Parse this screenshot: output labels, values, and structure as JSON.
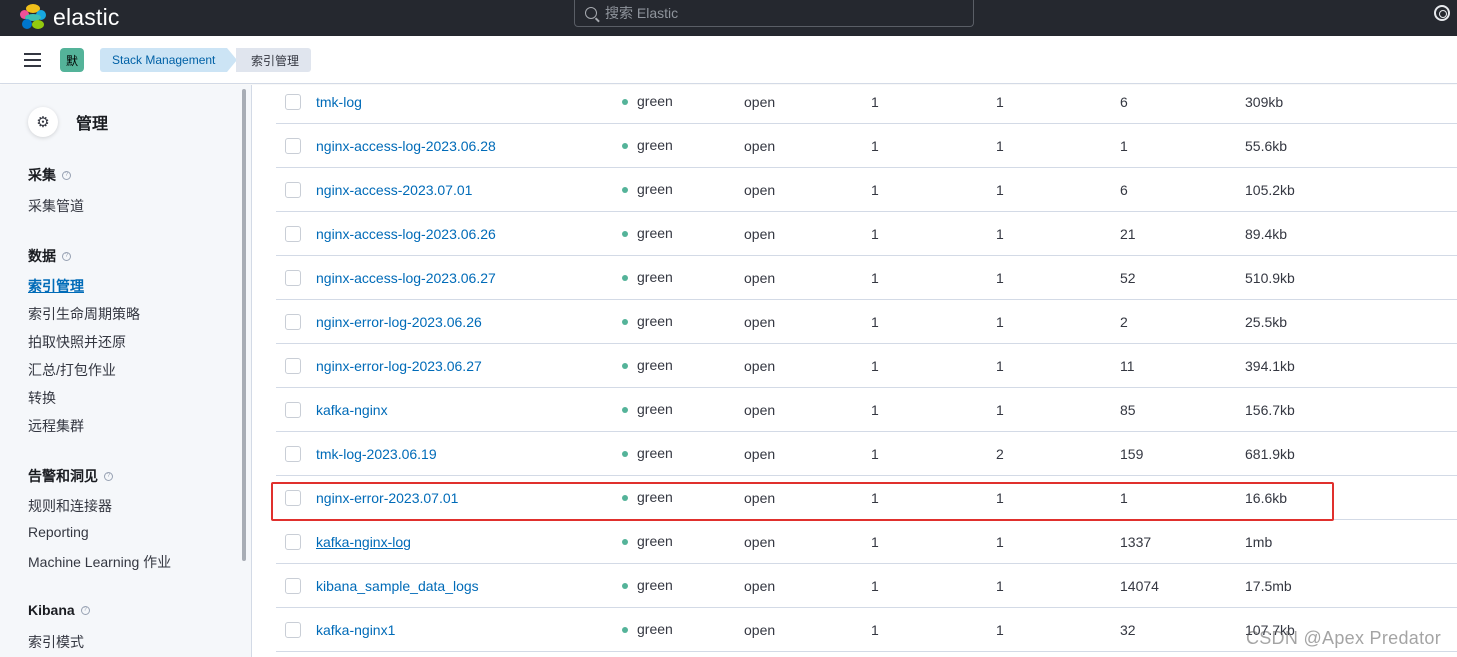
{
  "header": {
    "brand": "elastic",
    "search_placeholder": "搜索 Elastic",
    "logo_colors": [
      "#f0bf1a",
      "#3ebeb0",
      "#07c",
      "#ee5097",
      "#17a8e0",
      "#93c90e"
    ]
  },
  "breadcrumbs": {
    "space_initial": "默",
    "items": [
      "Stack Management",
      "索引管理"
    ]
  },
  "sidebar": {
    "title": "管理",
    "sections": [
      {
        "title": "采集",
        "items": [
          "采集管道"
        ]
      },
      {
        "title": "数据",
        "items": [
          "索引管理",
          "索引生命周期策略",
          "拍取快照并还原",
          "汇总/打包作业",
          "转换",
          "远程集群"
        ]
      },
      {
        "title": "告警和洞见",
        "items": [
          "规则和连接器",
          "Reporting",
          "Machine Learning 作业"
        ]
      },
      {
        "title": "Kibana",
        "items": [
          "索引模式"
        ]
      }
    ],
    "active_item": "索引管理"
  },
  "table": {
    "rows": [
      {
        "name": "tmk-log",
        "health": "green",
        "status": "open",
        "primaries": "1",
        "replicas": "1",
        "docs": "6",
        "size": "309kb"
      },
      {
        "name": "nginx-access-log-2023.06.28",
        "health": "green",
        "status": "open",
        "primaries": "1",
        "replicas": "1",
        "docs": "1",
        "size": "55.6kb"
      },
      {
        "name": "nginx-access-2023.07.01",
        "health": "green",
        "status": "open",
        "primaries": "1",
        "replicas": "1",
        "docs": "6",
        "size": "105.2kb"
      },
      {
        "name": "nginx-access-log-2023.06.26",
        "health": "green",
        "status": "open",
        "primaries": "1",
        "replicas": "1",
        "docs": "21",
        "size": "89.4kb"
      },
      {
        "name": "nginx-access-log-2023.06.27",
        "health": "green",
        "status": "open",
        "primaries": "1",
        "replicas": "1",
        "docs": "52",
        "size": "510.9kb"
      },
      {
        "name": "nginx-error-log-2023.06.26",
        "health": "green",
        "status": "open",
        "primaries": "1",
        "replicas": "1",
        "docs": "2",
        "size": "25.5kb"
      },
      {
        "name": "nginx-error-log-2023.06.27",
        "health": "green",
        "status": "open",
        "primaries": "1",
        "replicas": "1",
        "docs": "11",
        "size": "394.1kb"
      },
      {
        "name": "kafka-nginx",
        "health": "green",
        "status": "open",
        "primaries": "1",
        "replicas": "1",
        "docs": "85",
        "size": "156.7kb"
      },
      {
        "name": "tmk-log-2023.06.19",
        "health": "green",
        "status": "open",
        "primaries": "1",
        "replicas": "2",
        "docs": "159",
        "size": "681.9kb"
      },
      {
        "name": "nginx-error-2023.07.01",
        "health": "green",
        "status": "open",
        "primaries": "1",
        "replicas": "1",
        "docs": "1",
        "size": "16.6kb",
        "highlighted": true
      },
      {
        "name": "kafka-nginx-log",
        "health": "green",
        "status": "open",
        "primaries": "1",
        "replicas": "1",
        "docs": "1337",
        "size": "1mb",
        "hovered": true
      },
      {
        "name": "kibana_sample_data_logs",
        "health": "green",
        "status": "open",
        "primaries": "1",
        "replicas": "1",
        "docs": "14074",
        "size": "17.5mb"
      },
      {
        "name": "kafka-nginx1",
        "health": "green",
        "status": "open",
        "primaries": "1",
        "replicas": "1",
        "docs": "32",
        "size": "107.7kb"
      }
    ]
  },
  "watermark": "CSDN @Apex   Predator"
}
